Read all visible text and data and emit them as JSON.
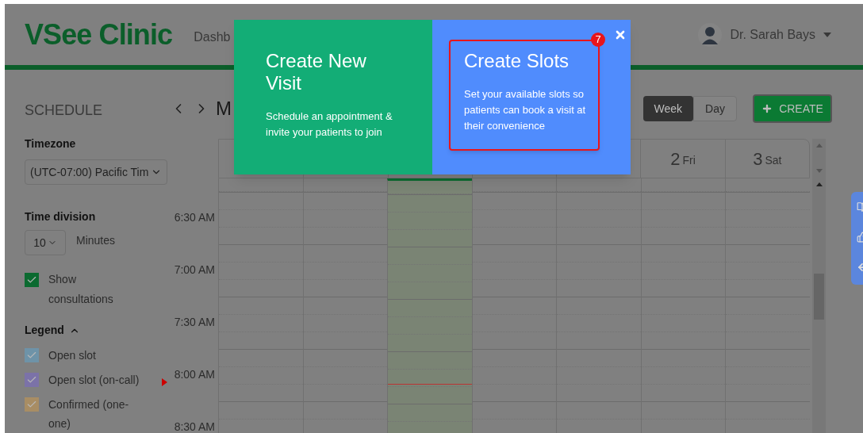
{
  "header": {
    "logo": "VSee Clinic",
    "nav_item": "Dashb",
    "user_name": "Dr. Sarah Bays"
  },
  "sidebar": {
    "title": "SCHEDULE",
    "timezone": {
      "label": "Timezone",
      "value": "(UTC-07:00) Pacific Tim"
    },
    "time_division": {
      "label": "Time division",
      "value": "10",
      "unit": "Minutes"
    },
    "show_consultations": {
      "label": "Show consultations",
      "checked": true
    },
    "legend": {
      "label": "Legend",
      "expanded": true,
      "items": [
        {
          "label": "Open slot",
          "color": "#6e93a8",
          "checked": true
        },
        {
          "label": "Open slot (on-call)",
          "color": "#7b72a8",
          "checked": true
        },
        {
          "label": "Confirmed (one-one)",
          "color": "#a88d64",
          "checked": true
        }
      ]
    }
  },
  "calendar": {
    "title": "M",
    "views": [
      {
        "label": "Week",
        "selected": true
      },
      {
        "label": "Day",
        "selected": false
      }
    ],
    "create_button": "CREATE",
    "days": [
      {
        "today": false
      },
      {
        "today": false
      },
      {
        "today": true
      },
      {
        "today": false
      },
      {
        "today": false
      },
      {
        "today": false,
        "number": "2",
        "weekday": "Fri"
      },
      {
        "today": false,
        "number": "3",
        "weekday": "Sat"
      }
    ],
    "times": [
      "6:30 AM",
      "7:00 AM",
      "7:30 AM",
      "8:00 AM",
      "8:30 AM"
    ]
  },
  "modal": {
    "cards": [
      {
        "title": "Create New Visit",
        "text": "Schedule an appointment & invite your patients to join",
        "color": "#13ad76",
        "highlighted": false
      },
      {
        "title": "Create Slots",
        "text": "Set your available slots so patients can book a visit at their convenience",
        "color": "#508cfd",
        "highlighted": true,
        "badge": "7"
      }
    ]
  }
}
